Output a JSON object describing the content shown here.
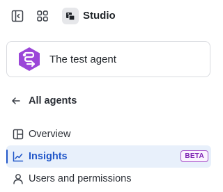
{
  "header": {
    "app_title": "Studio",
    "icons": {
      "sidebar_toggle": "sidebar-toggle-icon",
      "apps_grid": "apps-grid-icon",
      "studio_logo": "studio-logo-icon"
    }
  },
  "agent": {
    "name": "The test agent",
    "avatar_color": "#9b46d8"
  },
  "back_link": {
    "label": "All agents",
    "icon": "arrow-left-icon"
  },
  "nav": {
    "items": [
      {
        "label": "Overview",
        "icon": "layout-icon",
        "active": false
      },
      {
        "label": "Insights",
        "icon": "chart-line-icon",
        "active": true,
        "badge": "BETA"
      },
      {
        "label": "Users and permissions",
        "icon": "user-icon",
        "active": false
      }
    ]
  },
  "colors": {
    "accent": "#2157c9",
    "active_bg": "#e8f0fb",
    "badge": "#7e22b3"
  }
}
